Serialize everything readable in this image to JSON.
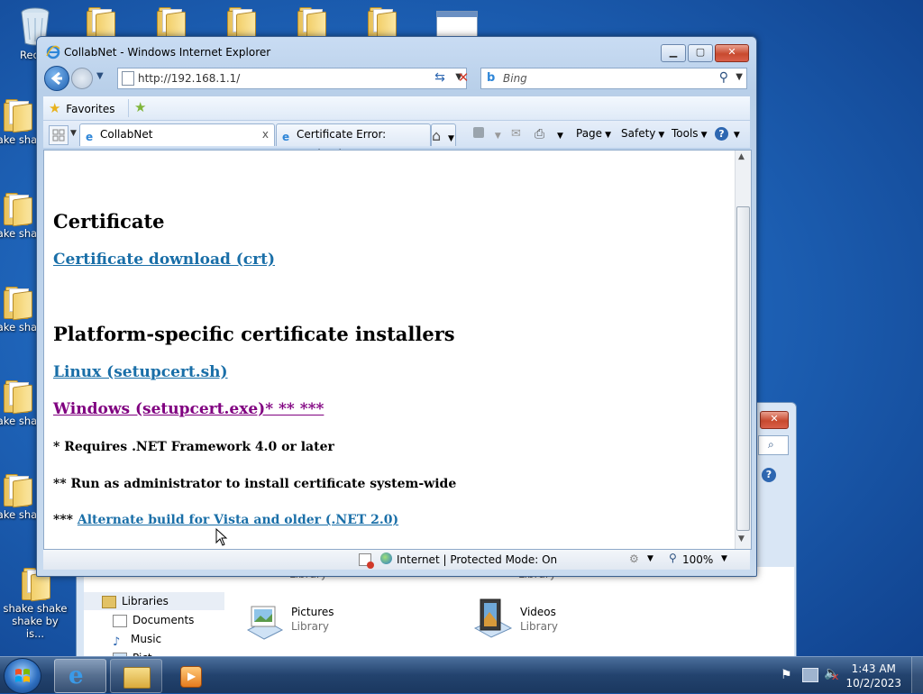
{
  "desktop": {
    "icons": [
      {
        "label": "Recyc"
      },
      {
        "label": "shake shake"
      },
      {
        "label": "shake shake"
      },
      {
        "label": "shake shake"
      },
      {
        "label": "shake shake"
      },
      {
        "label": "shake shake"
      },
      {
        "label": "shake shake shake by is..."
      }
    ]
  },
  "explorer": {
    "nav_items": [
      "Libraries",
      "Documents",
      "Music",
      "Pict..."
    ],
    "libraries": [
      {
        "name": "Library"
      },
      {
        "name": "Library"
      },
      {
        "name": "Pictures",
        "sub": "Library"
      },
      {
        "name": "Videos",
        "sub": "Library"
      }
    ]
  },
  "ie": {
    "title": "CollabNet - Windows Internet Explorer",
    "address": "http://192.168.1.1/",
    "search_placeholder": "Bing",
    "favorites_label": "Favorites",
    "tabs": [
      {
        "label": "CollabNet",
        "close": "x"
      },
      {
        "label": "Certificate Error: Navigati..."
      }
    ],
    "commands": {
      "page": "Page",
      "safety": "Safety",
      "tools": "Tools"
    },
    "status": {
      "zone": "Internet | Protected Mode: On",
      "zoom": "100%"
    }
  },
  "page": {
    "heading_certificate": "Certificate",
    "link_crt": "Certificate download (crt)",
    "heading_installers": "Platform-specific certificate installers",
    "link_linux": "Linux (setupcert.sh)",
    "link_windows": "Windows (setupcert.exe)* ** ***",
    "note1": "* Requires .NET Framework 4.0 or later",
    "note2": "** Run as administrator to install certificate system-wide",
    "note3_prefix": "***",
    "link_alt": "Alternate build for Vista and older (.NET 2.0)"
  },
  "taskbar": {
    "time": "1:43 AM",
    "date": "10/2/2023"
  },
  "colors": {
    "link": "#1a6fa8",
    "visited_link": "#800080",
    "accent": "#2e67b1"
  }
}
